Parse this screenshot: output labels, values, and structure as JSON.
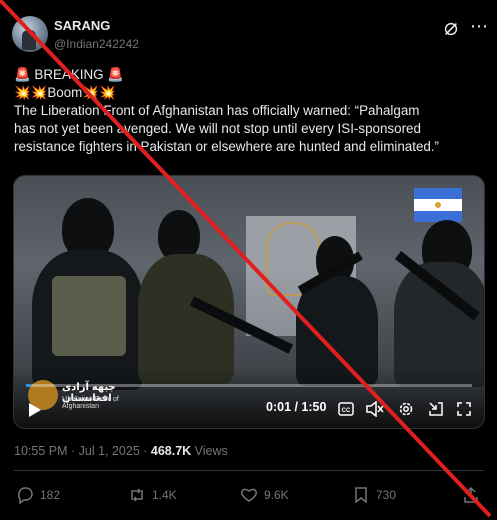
{
  "author": {
    "name": "SARANG",
    "handle": "@Indian242242"
  },
  "post": {
    "line1": "🚨 BREAKING 🚨",
    "line2": "💥💥Boom💥💥",
    "line3": "The Liberation Front of Afghanistan has officially  warned: “Pahalgam",
    "line4": "has not yet been avenged. We will not stop until every ISI-sponsored",
    "line5": "resistance fighters in Pakistan or elsewhere are hunted and eliminated.”"
  },
  "video": {
    "logo_title": "جبهه آزادی افغانستان",
    "logo_subtitle": "Liberation Front of Afghanistan",
    "time": "0:01 / 1:50",
    "progress": 0.01
  },
  "meta": {
    "time": "10:55 PM · Jul 1, 2025 · ",
    "views_count": "468.7K",
    "views_label": " Views"
  },
  "actions": {
    "replies": "182",
    "reposts": "1.4K",
    "likes": "9.6K",
    "bookmarks": "730"
  },
  "colors": {
    "accent": "#1d9bf0",
    "cross": "#e0201e"
  }
}
